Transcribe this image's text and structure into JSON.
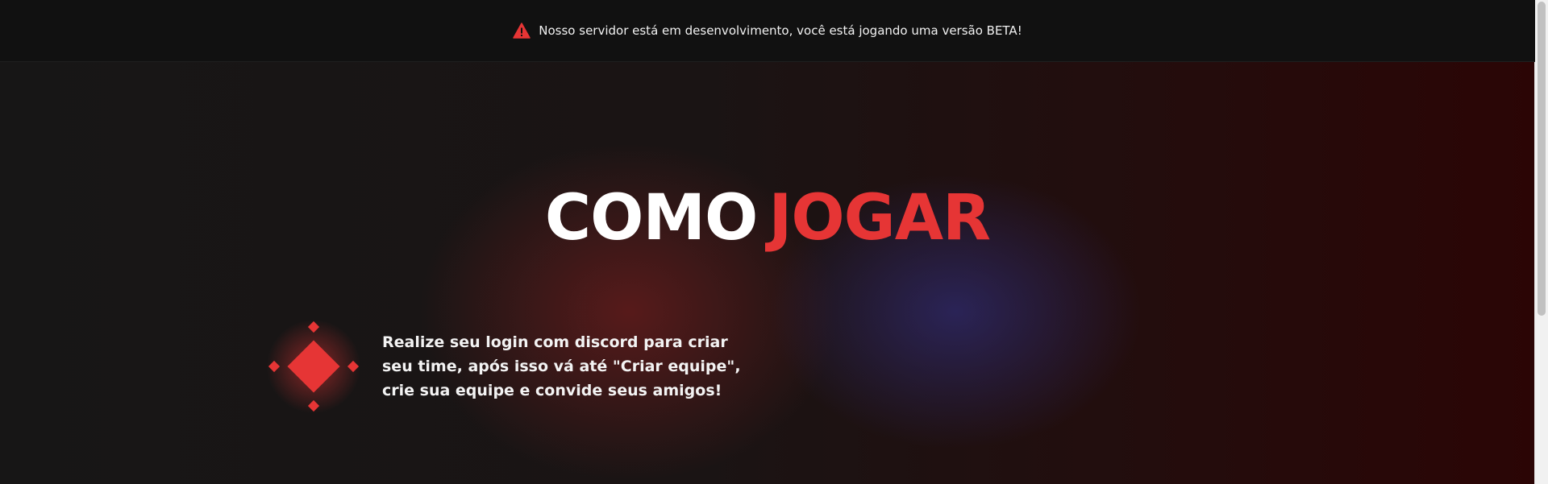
{
  "banner": {
    "icon": "warning-triangle-icon",
    "text": "Nosso servidor está em desenvolvimento, você está jogando uma versão BETA!"
  },
  "hero": {
    "title_white": "COMO",
    "title_red": "JOGAR",
    "step": {
      "icon": "diamond-icon",
      "text": "Realize seu login com discord para criar seu time, após isso vá até \"Criar equipe\", crie sua equipe e convide seus amigos!"
    }
  },
  "colors": {
    "accent": "#e63535",
    "banner_bg": "#111111",
    "page_bg": "#151414",
    "text": "#ffffff"
  }
}
